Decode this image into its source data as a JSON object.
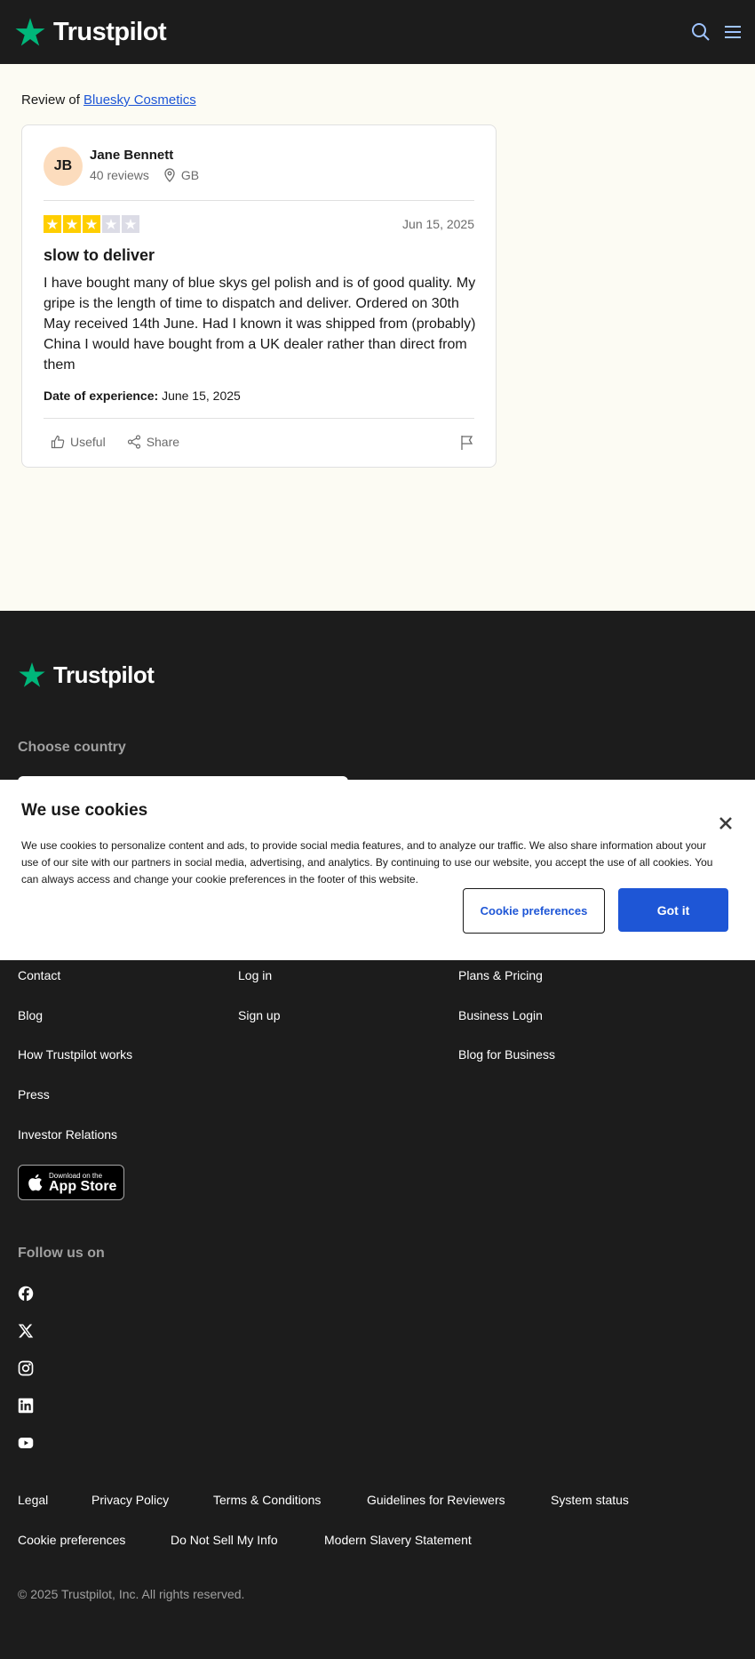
{
  "header": {
    "logo_text": "Trustpilot",
    "brand_color": "#00b67a"
  },
  "review": {
    "review_of_prefix": "Review of",
    "business_name": "Bluesky Cosmetics",
    "reviewer": {
      "initials": "JB",
      "name": "Jane Bennett",
      "review_count": "40 reviews",
      "country": "GB"
    },
    "rating": 3,
    "rating_max": 5,
    "date": "Jun 15, 2025",
    "title": "slow to deliver",
    "body": "I have bought many of blue skys gel polish and is of good quality. My gripe is the length of time to dispatch and deliver. Ordered on 30th May received 14th June. Had I known it was shipped from (probably) China I would have bought from a UK dealer rather than direct from them",
    "experience_label": "Date of experience:",
    "experience_date": "June 15, 2025",
    "useful_label": "Useful",
    "share_label": "Share"
  },
  "footer": {
    "logo_text": "Trustpilot",
    "choose_country": "Choose country",
    "col1": [
      "Contact",
      "Blog",
      "How Trustpilot works",
      "Press",
      "Investor Relations"
    ],
    "col2": [
      "Log in",
      "Sign up"
    ],
    "col3": [
      "Plans & Pricing",
      "Business Login",
      "Blog for Business"
    ],
    "appstore_small": "Download on the",
    "appstore_big": "App Store",
    "follow_us": "Follow us on",
    "social_icons": [
      "facebook-icon",
      "x-icon",
      "instagram-icon",
      "linkedin-icon",
      "youtube-icon"
    ],
    "legal_row1": [
      "Legal",
      "Privacy Policy",
      "Terms & Conditions",
      "Guidelines for Reviewers",
      "System status"
    ],
    "legal_row2": [
      "Cookie preferences",
      "Do Not Sell My Info",
      "Modern Slavery Statement"
    ],
    "copyright": "© 2025 Trustpilot, Inc. All rights reserved."
  },
  "cookie_banner": {
    "title": "We use cookies",
    "text": "We use cookies to personalize content and ads, to provide social media features, and to analyze our traffic. We also share information about your use of our site with our partners in social media, advertising, and analytics. By continuing to use our website, you accept the use of all cookies. You can always access and change your cookie preferences in the footer of this website.",
    "preferences_button": "Cookie preferences",
    "accept_button": "Got it"
  }
}
